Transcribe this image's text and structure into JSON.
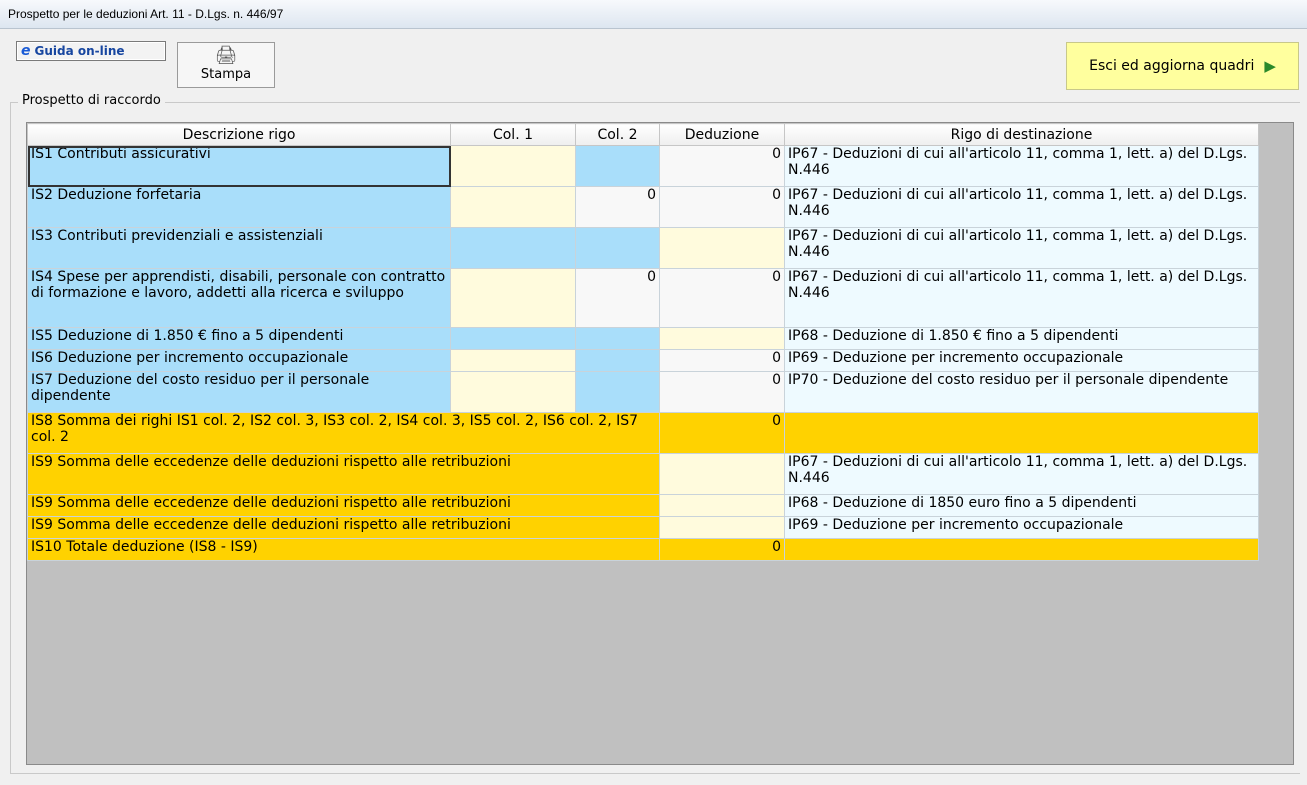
{
  "window": {
    "title": "Prospetto per le deduzioni Art. 11 - D.Lgs. n. 446/97"
  },
  "toolbar": {
    "guida_label": "Guida on-line",
    "guida_icon": "e",
    "stampa_label": "Stampa",
    "esci_label": "Esci ed aggiorna quadri"
  },
  "section": {
    "label": "Prospetto di raccordo"
  },
  "table": {
    "headers": [
      "Descrizione rigo",
      "Col. 1",
      "Col. 2",
      "Deduzione",
      "Rigo di destinazione"
    ],
    "rows": [
      {
        "desc": "IS1 Contributi assicurativi",
        "col1": "",
        "col2": "",
        "ded": "0",
        "dest": "IP67  - Deduzioni di cui all'articolo 11, comma 1, lett. a) del D.Lgs. N.446"
      },
      {
        "desc": "IS2 Deduzione forfetaria",
        "col1": "",
        "col2": "0",
        "ded": "0",
        "dest": "IP67  - Deduzioni di cui all'articolo 11, comma 1, lett. a) del D.Lgs. N.446"
      },
      {
        "desc": "IS3 Contributi previdenziali e assistenziali",
        "col1": "",
        "col2": "",
        "ded": "",
        "dest": "IP67  - Deduzioni di cui all'articolo 11, comma 1, lett. a) del D.Lgs. N.446"
      },
      {
        "desc": "IS4 Spese per apprendisti, disabili, personale con contratto di formazione e lavoro, addetti alla ricerca e sviluppo",
        "col1": "",
        "col2": "0",
        "ded": "0",
        "dest": "IP67  - Deduzioni di cui all'articolo 11, comma 1, lett. a) del D.Lgs. N.446"
      },
      {
        "desc": "IS5 Deduzione di 1.850 € fino a 5 dipendenti",
        "col1": "",
        "col2": "",
        "ded": "",
        "dest": "IP68 - Deduzione di 1.850 € fino a 5 dipendenti"
      },
      {
        "desc": "IS6 Deduzione per incremento occupazionale",
        "col1": "",
        "col2": "",
        "ded": "0",
        "dest": "IP69 - Deduzione per incremento occupazionale"
      },
      {
        "desc": "IS7 Deduzione del costo residuo per il personale dipendente",
        "col1": "",
        "col2": "",
        "ded": "0",
        "dest": "IP70 - Deduzione del costo residuo per il personale dipendente"
      }
    ],
    "sum_rows": [
      {
        "desc": "IS8 Somma dei righi IS1 col. 2, IS2 col. 3, IS3 col. 2, IS4 col. 3, IS5 col. 2, IS6 col. 2, IS7 col. 2",
        "ded": "0",
        "dest": ""
      },
      {
        "desc": "IS9 Somma delle eccedenze delle deduzioni rispetto alle retribuzioni",
        "ded": "",
        "dest": "IP67  - Deduzioni di cui all'articolo 11, comma 1, lett. a) del D.Lgs. N.446"
      },
      {
        "desc": "IS9 Somma delle eccedenze delle deduzioni rispetto alle retribuzioni",
        "ded": "",
        "dest": "IP68 - Deduzione di 1850 euro fino a 5 dipendenti"
      },
      {
        "desc": "IS9 Somma delle eccedenze delle deduzioni rispetto alle retribuzioni",
        "ded": "",
        "dest": "IP69 - Deduzione per incremento occupazionale"
      },
      {
        "desc": "IS10 Totale deduzione (IS8 - IS9)",
        "ded": "0",
        "dest": ""
      }
    ]
  },
  "colors": {
    "desc_bg": "#a9defa",
    "input_bg": "#fffbdd",
    "sum_bg": "#ffd200",
    "dest_bg": "#eefaff",
    "esci_bg": "#ffff9e"
  },
  "icons": {
    "guida": "ie-icon",
    "stampa": "printer-icon",
    "esci": "exit-door-icon"
  }
}
